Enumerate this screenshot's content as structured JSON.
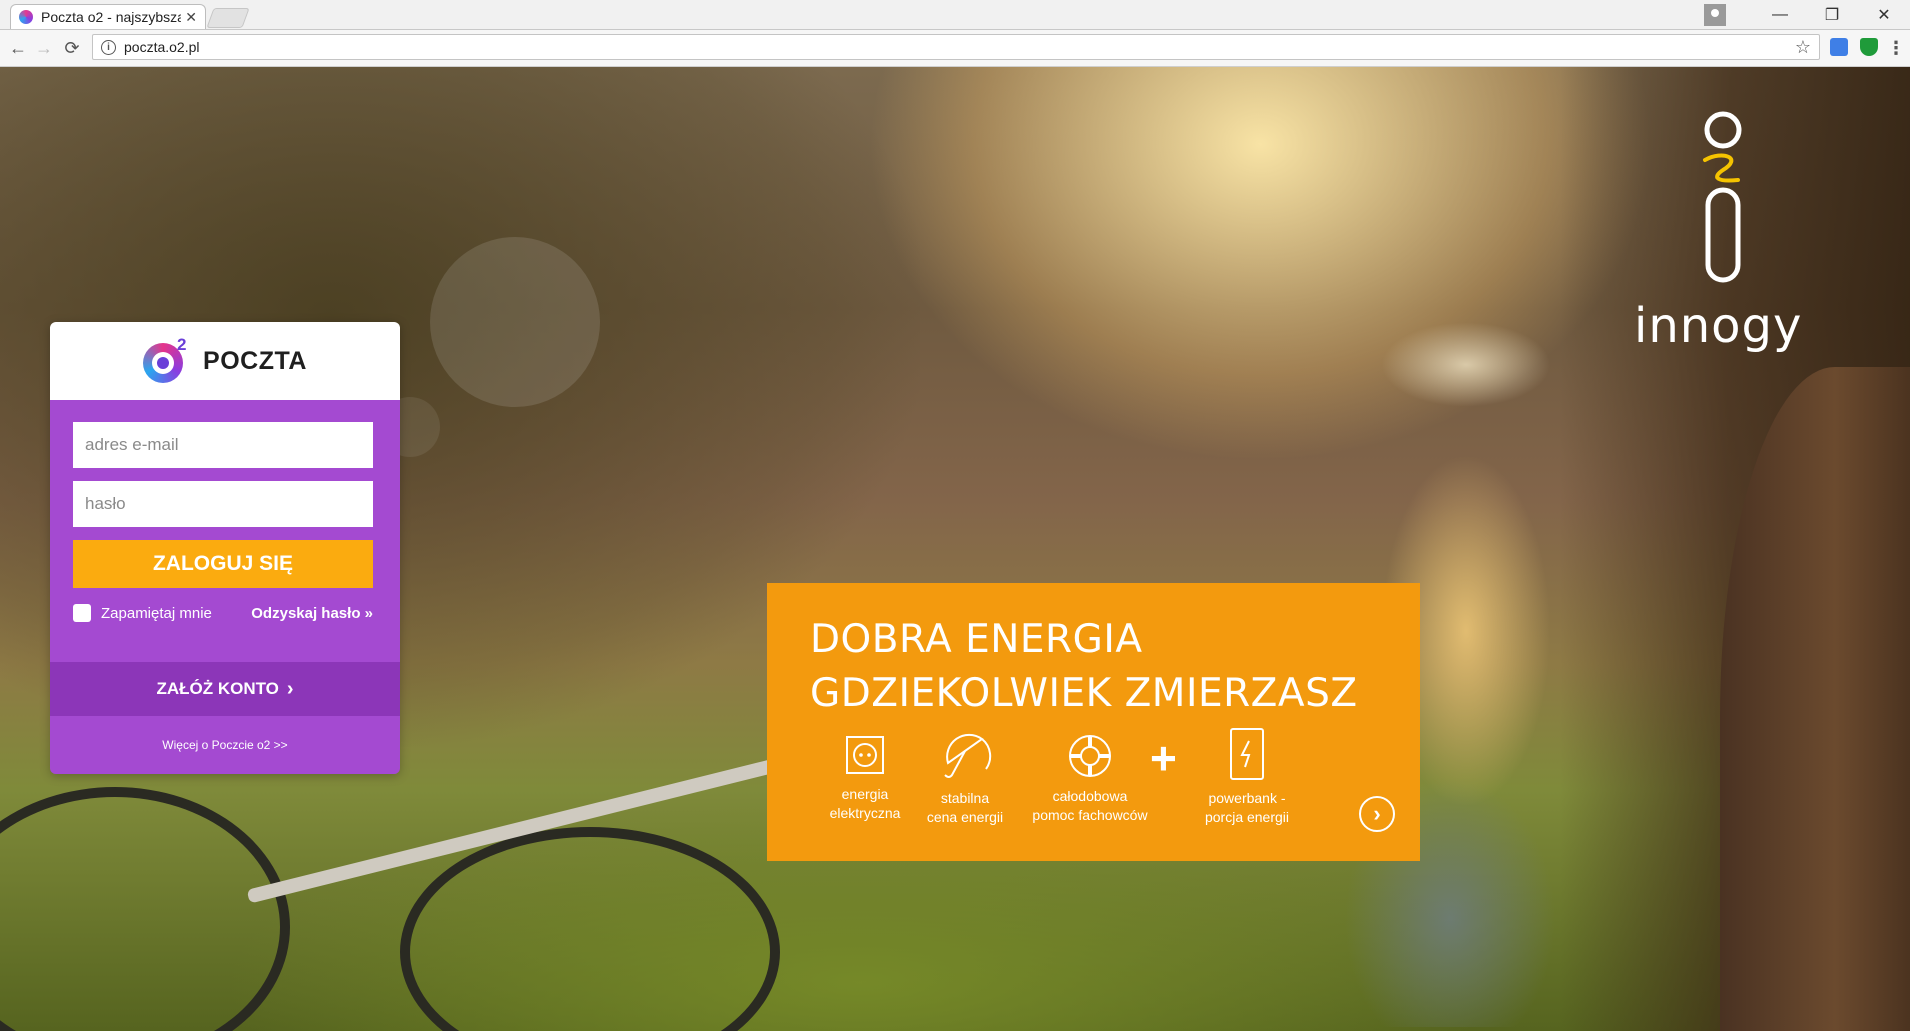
{
  "browser": {
    "tab_title": "Poczta o2 - najszybsza",
    "tab_close": "✕",
    "url": "poczta.o2.pl",
    "window": {
      "minimize": "—",
      "restore": "❐",
      "close": "✕"
    },
    "nav": {
      "back": "←",
      "forward": "→",
      "reload": "⟳",
      "star": "☆",
      "menu": "⋮",
      "info": "i"
    }
  },
  "login": {
    "logo_sup": "2",
    "logo_text": "POCZTA",
    "email_placeholder": "adres e-mail",
    "password_placeholder": "hasło",
    "login_button": "ZALOGUJ SIĘ",
    "remember_label": "Zapamiętaj mnie",
    "recover_link": "Odzyskaj hasło »",
    "register_label": "ZAŁÓŻ KONTO",
    "register_chevron": "›",
    "more_link": "Więcej o Poczcie o2 >>"
  },
  "brand": {
    "innogy": "innogy"
  },
  "promo": {
    "title_line1": "DOBRA ENERGIA",
    "title_line2": "GDZIEKOLWIEK ZMIERZASZ",
    "features": [
      {
        "line1": "energia",
        "line2": "elektryczna",
        "icon": "socket-icon"
      },
      {
        "line1": "stabilna",
        "line2": "cena energii",
        "icon": "umbrella-icon"
      },
      {
        "line1": "całodobowa",
        "line2": "pomoc fachowców",
        "icon": "lifebuoy-icon"
      },
      {
        "line1": "powerbank -",
        "line2": "porcja energii",
        "icon": "powerbank-icon"
      }
    ],
    "plus": "+",
    "next": "›"
  },
  "colors": {
    "login_purple": "#a44ad1",
    "register_purple": "#8c36b8",
    "login_button": "#fbab0f",
    "promo_orange": "#f39a0e"
  }
}
